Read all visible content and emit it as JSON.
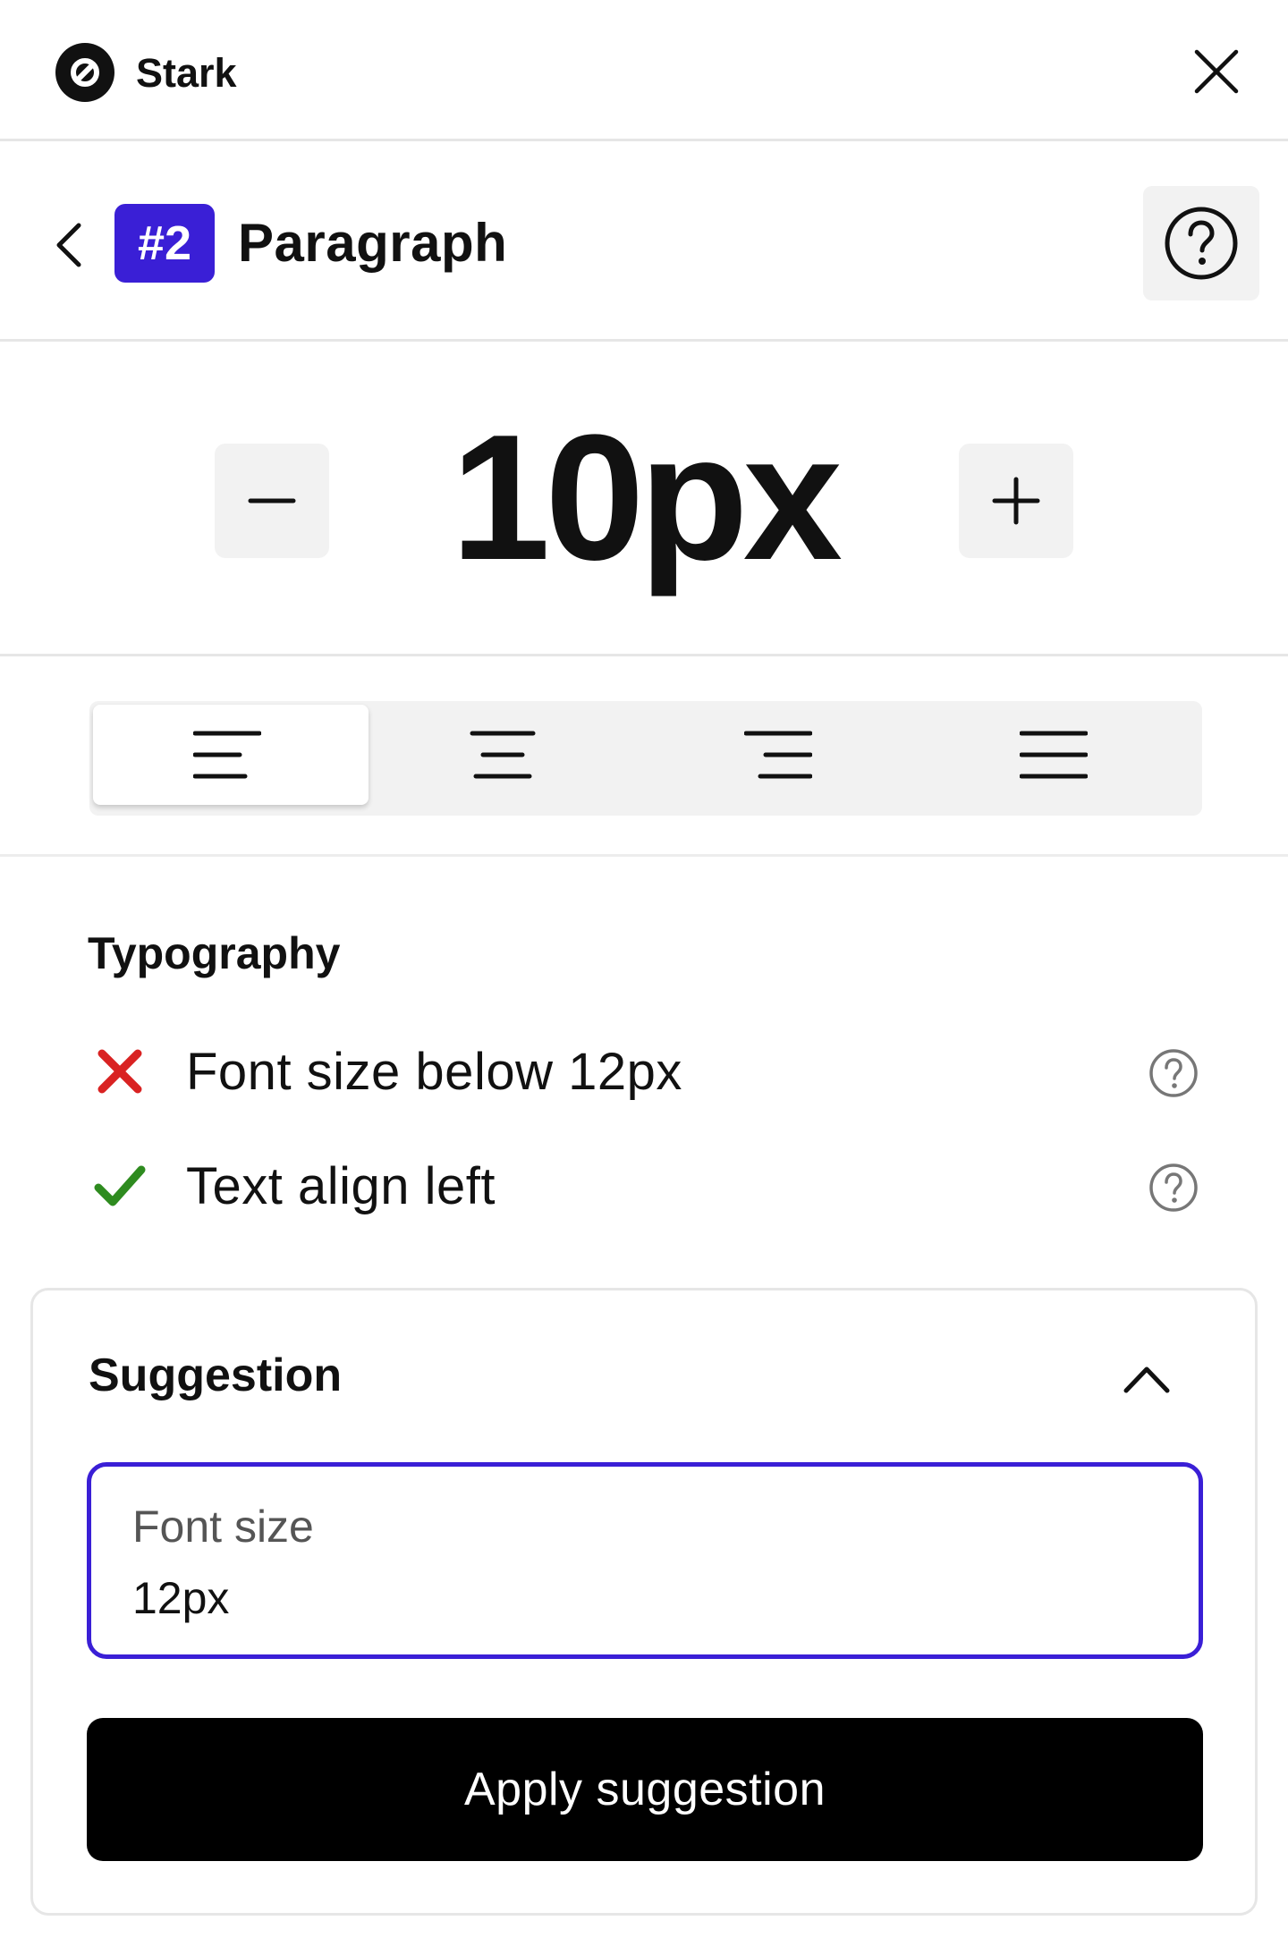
{
  "app": {
    "name": "Stark",
    "logo_icon": "stark-logo-icon",
    "close_icon": "close-icon"
  },
  "header": {
    "back_icon": "chevron-left-icon",
    "badge": "#2",
    "title": "Paragraph",
    "help_icon": "help-circle-icon",
    "badge_color": "#3a1fd6"
  },
  "font_size": {
    "value": "10px",
    "decrement_icon": "minus-icon",
    "increment_icon": "plus-icon"
  },
  "alignment": {
    "options": [
      {
        "name": "align-left",
        "icon": "align-left-icon",
        "selected": true
      },
      {
        "name": "align-center",
        "icon": "align-center-icon",
        "selected": false
      },
      {
        "name": "align-right",
        "icon": "align-right-icon",
        "selected": false
      },
      {
        "name": "align-justify",
        "icon": "align-justify-icon",
        "selected": false
      }
    ]
  },
  "typography": {
    "title": "Typography",
    "checks": [
      {
        "label": "Font size below 12px",
        "status": "fail",
        "status_icon": "x-icon",
        "status_color": "#d92222",
        "info_icon": "help-circle-icon"
      },
      {
        "label": "Text align left",
        "status": "pass",
        "status_icon": "checkmark-icon",
        "status_color": "#2e8b1f",
        "info_icon": "help-circle-icon"
      }
    ]
  },
  "suggestion": {
    "title": "Suggestion",
    "collapse_icon": "chevron-up-icon",
    "field_label": "Font size",
    "field_value": "12px",
    "apply_label": "Apply suggestion",
    "field_border_color": "#3a1fd6"
  }
}
